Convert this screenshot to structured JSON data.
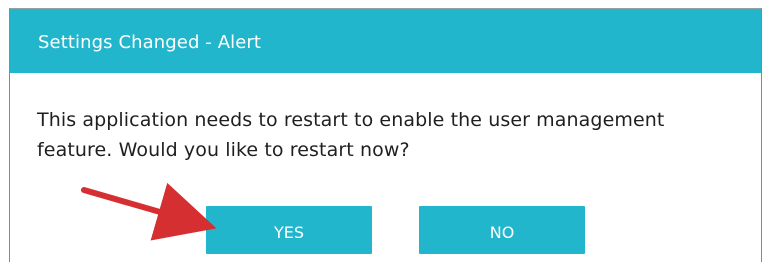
{
  "dialog": {
    "title": "Settings Changed - Alert",
    "message": "This application needs to restart to enable the user management feature. Would you like to restart now?",
    "buttons": {
      "yes_label": "YES",
      "no_label": "NO"
    }
  },
  "colors": {
    "accent": "#22b6cd",
    "arrow": "#d62f32"
  },
  "icons": {
    "annotation": "red-arrow-icon"
  }
}
